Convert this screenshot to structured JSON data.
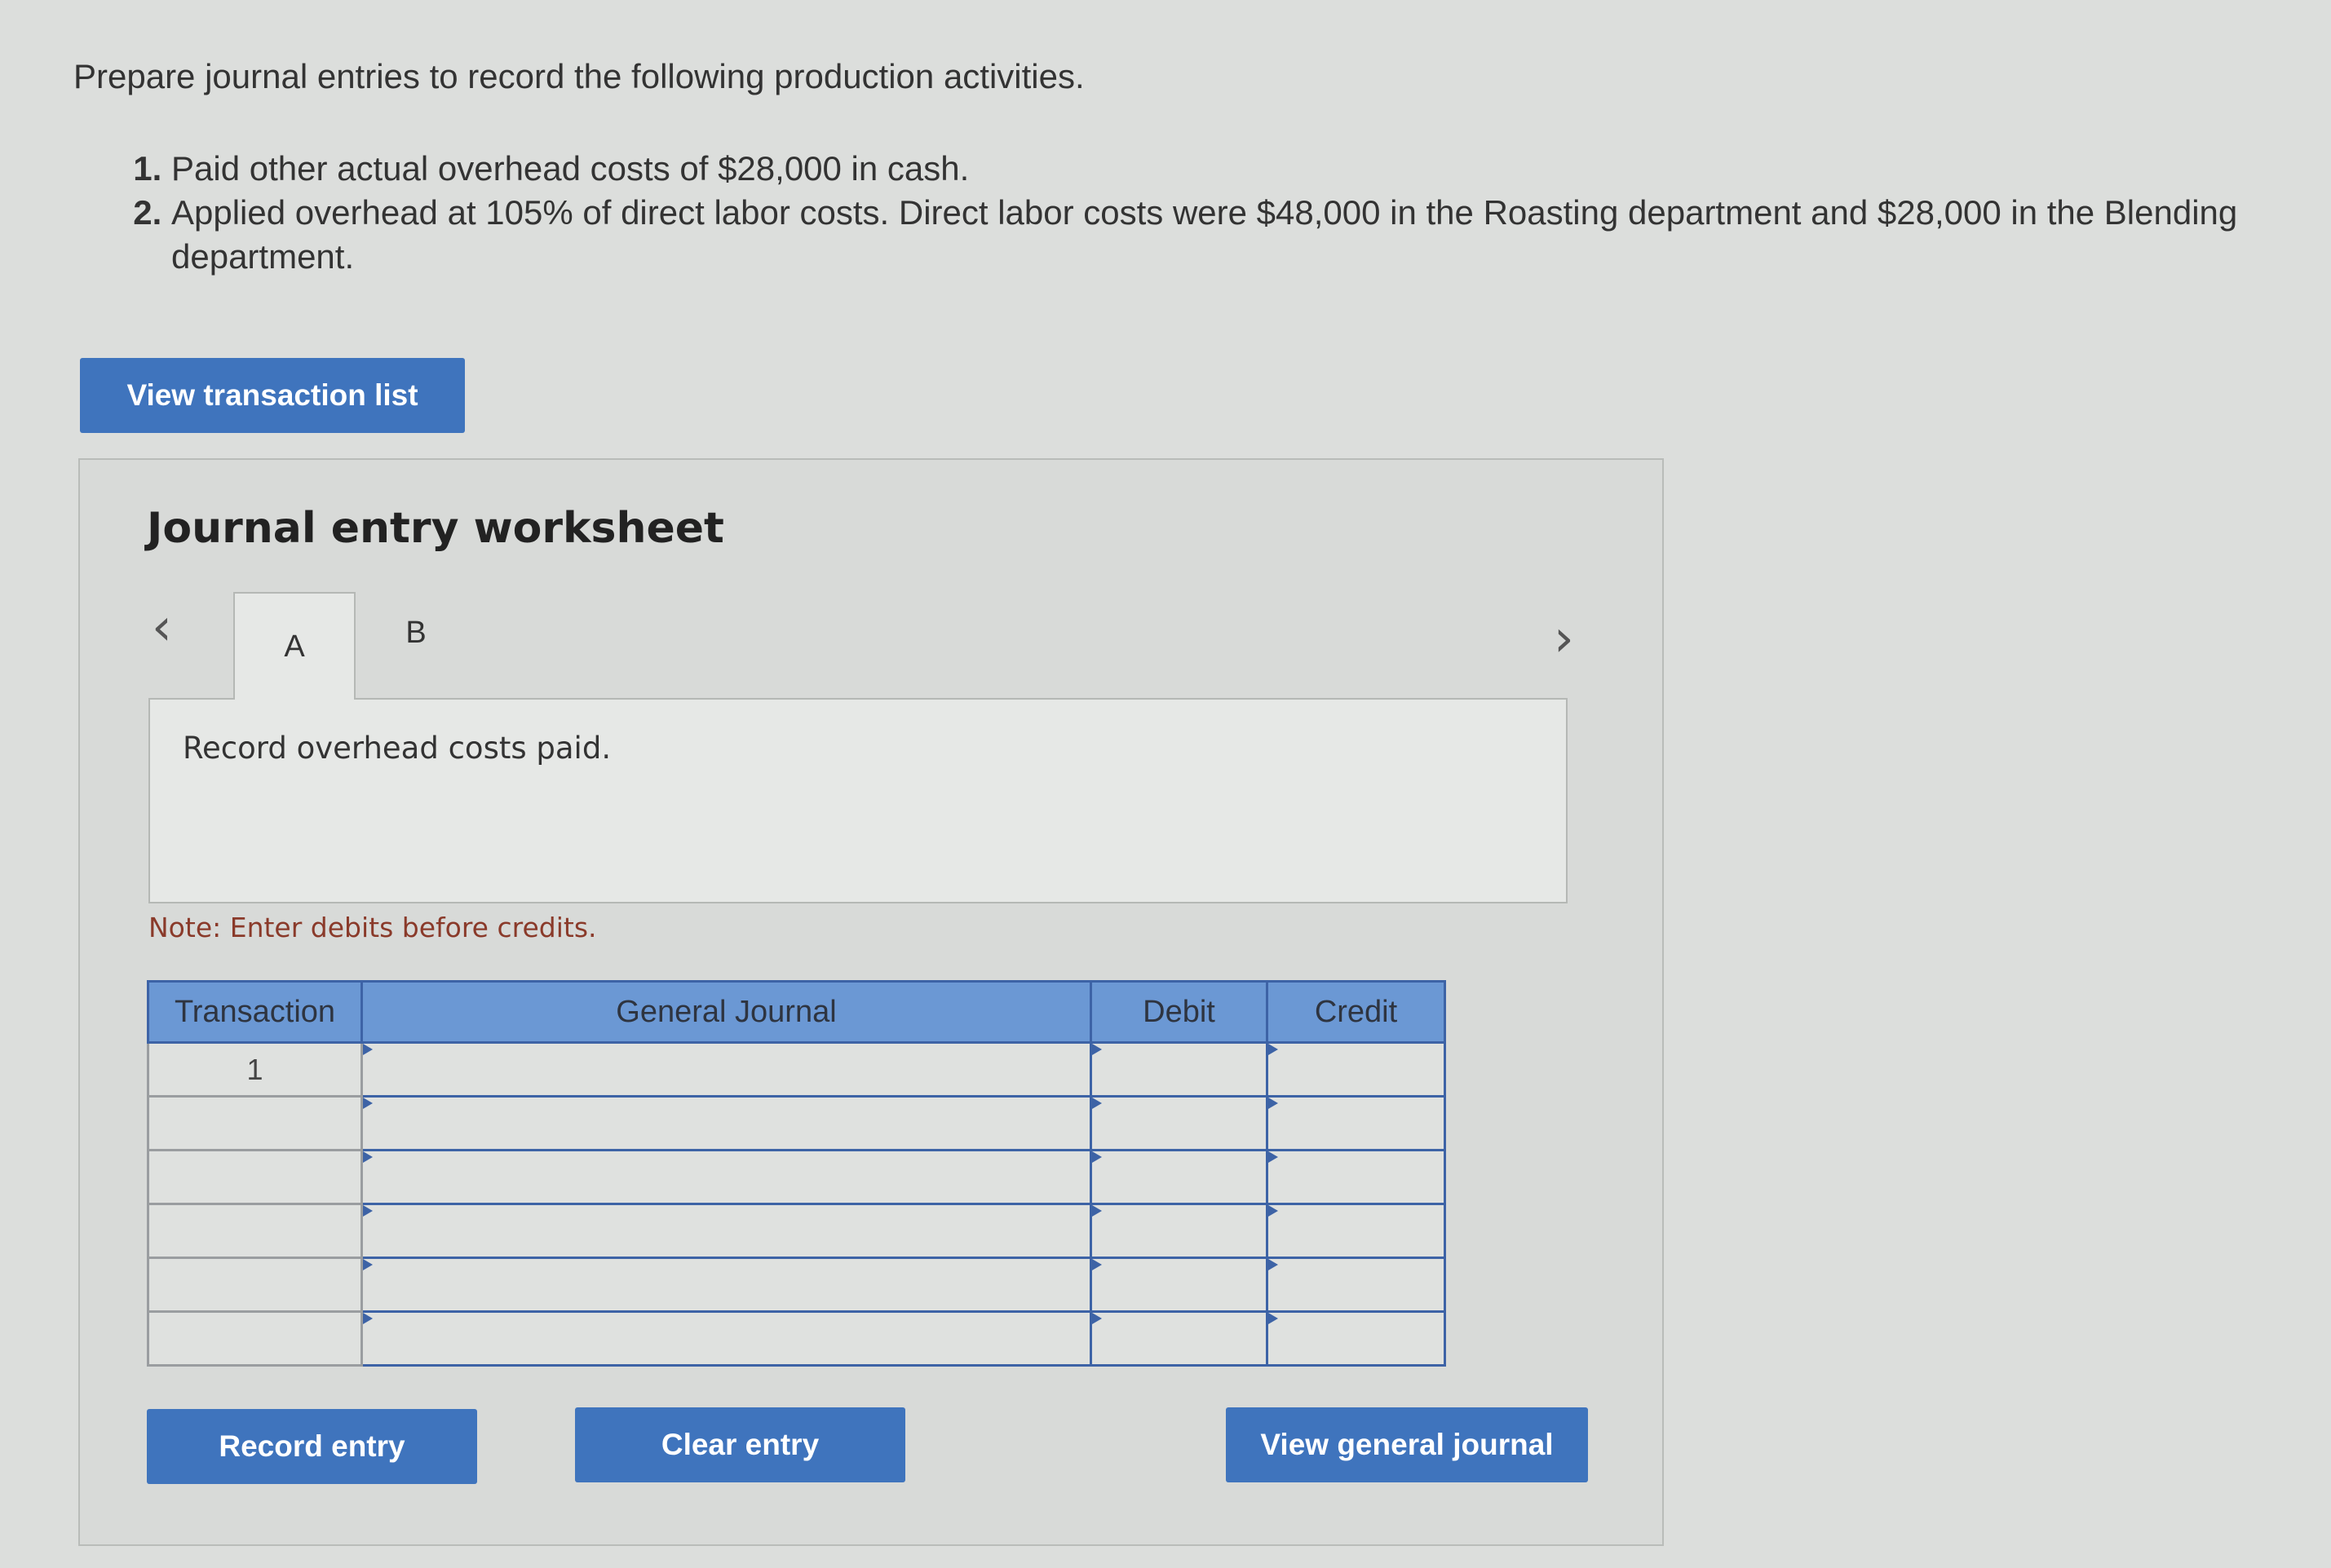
{
  "problem": {
    "intro": "Prepare journal entries to record the following production activities.",
    "steps": [
      "Paid other actual overhead costs of $28,000 in cash.",
      "Applied overhead at 105% of direct labor costs. Direct labor costs were $48,000 in the Roasting department and $28,000 in the Blending department."
    ]
  },
  "buttons": {
    "view_transactions": "View transaction list",
    "record_entry": "Record entry",
    "clear_entry": "Clear entry",
    "view_general_journal": "View general journal"
  },
  "worksheet": {
    "title": "Journal entry worksheet",
    "prev_icon": "‹",
    "next_icon": "›",
    "tabs": [
      "A",
      "B"
    ],
    "active_tab": "A",
    "instruction": "Record overhead costs paid.",
    "note": "Note: Enter debits before credits.",
    "table": {
      "headers": [
        "Transaction",
        "General Journal",
        "Debit",
        "Credit"
      ],
      "rows": [
        {
          "transaction": "1",
          "account": "",
          "debit": "",
          "credit": ""
        },
        {
          "transaction": "",
          "account": "",
          "debit": "",
          "credit": ""
        },
        {
          "transaction": "",
          "account": "",
          "debit": "",
          "credit": ""
        },
        {
          "transaction": "",
          "account": "",
          "debit": "",
          "credit": ""
        },
        {
          "transaction": "",
          "account": "",
          "debit": "",
          "credit": ""
        },
        {
          "transaction": "",
          "account": "",
          "debit": "",
          "credit": ""
        }
      ]
    }
  },
  "colors": {
    "button": "#3f74bd",
    "table_header": "#6b98d4",
    "table_border": "#3d63a6",
    "note_text": "#8a3a2a"
  }
}
